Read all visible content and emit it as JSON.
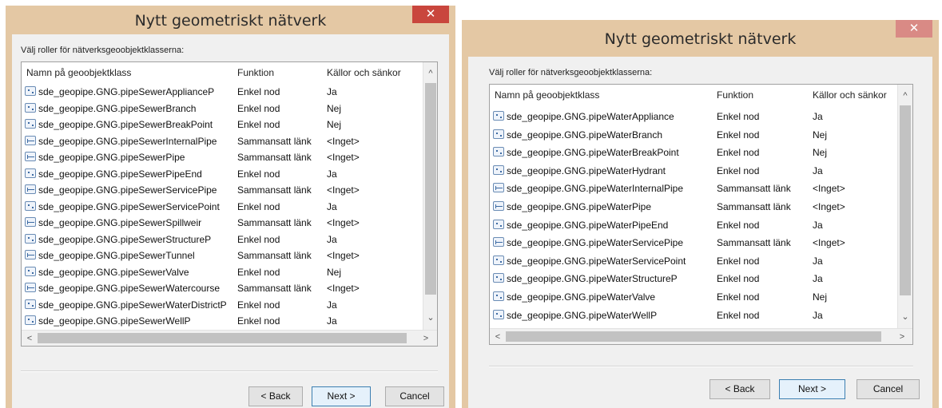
{
  "left_dialog": {
    "title": "Nytt geometriskt nätverk",
    "close": "✕",
    "prompt": "Välj roller för nätverksgeoobjektklasserna:",
    "columns": [
      "Namn på geoobjektklass",
      "Funktion",
      "Källor och sänkor"
    ],
    "rows": [
      {
        "icon": "point",
        "name": "sde_geopipe.GNG.pipeSewerApplianceP",
        "function": "Enkel nod",
        "sources": "Ja"
      },
      {
        "icon": "point",
        "name": "sde_geopipe.GNG.pipeSewerBranch",
        "function": "Enkel nod",
        "sources": "Nej"
      },
      {
        "icon": "point",
        "name": "sde_geopipe.GNG.pipeSewerBreakPoint",
        "function": "Enkel nod",
        "sources": "Nej"
      },
      {
        "icon": "line",
        "name": "sde_geopipe.GNG.pipeSewerInternalPipe",
        "function": "Sammansatt länk",
        "sources": "<Inget>"
      },
      {
        "icon": "line",
        "name": "sde_geopipe.GNG.pipeSewerPipe",
        "function": "Sammansatt länk",
        "sources": "<Inget>"
      },
      {
        "icon": "point",
        "name": "sde_geopipe.GNG.pipeSewerPipeEnd",
        "function": "Enkel nod",
        "sources": "Ja"
      },
      {
        "icon": "line",
        "name": "sde_geopipe.GNG.pipeSewerServicePipe",
        "function": "Sammansatt länk",
        "sources": "<Inget>"
      },
      {
        "icon": "point",
        "name": "sde_geopipe.GNG.pipeSewerServicePoint",
        "function": "Enkel nod",
        "sources": "Ja"
      },
      {
        "icon": "line",
        "name": "sde_geopipe.GNG.pipeSewerSpillweir",
        "function": "Sammansatt länk",
        "sources": "<Inget>"
      },
      {
        "icon": "point",
        "name": "sde_geopipe.GNG.pipeSewerStructureP",
        "function": "Enkel nod",
        "sources": "Ja"
      },
      {
        "icon": "line",
        "name": "sde_geopipe.GNG.pipeSewerTunnel",
        "function": "Sammansatt länk",
        "sources": "<Inget>"
      },
      {
        "icon": "point",
        "name": "sde_geopipe.GNG.pipeSewerValve",
        "function": "Enkel nod",
        "sources": "Nej"
      },
      {
        "icon": "line",
        "name": "sde_geopipe.GNG.pipeSewerWatercourse",
        "function": "Sammansatt länk",
        "sources": "<Inget>"
      },
      {
        "icon": "point",
        "name": "sde_geopipe.GNG.pipeSewerWaterDistrictP",
        "function": "Enkel nod",
        "sources": "Ja"
      },
      {
        "icon": "point",
        "name": "sde_geopipe.GNG.pipeSewerWellP",
        "function": "Enkel nod",
        "sources": "Ja"
      }
    ],
    "buttons": {
      "back": "< Back",
      "next": "Next >",
      "cancel": "Cancel"
    }
  },
  "right_dialog": {
    "title": "Nytt geometriskt nätverk",
    "close": "✕",
    "prompt": "Välj roller för nätverksgeoobjektklasserna:",
    "columns": [
      "Namn på geoobjektklass",
      "Funktion",
      "Källor och sänkor"
    ],
    "rows": [
      {
        "icon": "point",
        "name": "sde_geopipe.GNG.pipeWaterAppliance",
        "function": "Enkel nod",
        "sources": "Ja"
      },
      {
        "icon": "point",
        "name": "sde_geopipe.GNG.pipeWaterBranch",
        "function": "Enkel nod",
        "sources": "Nej"
      },
      {
        "icon": "point",
        "name": "sde_geopipe.GNG.pipeWaterBreakPoint",
        "function": "Enkel nod",
        "sources": "Nej"
      },
      {
        "icon": "point",
        "name": "sde_geopipe.GNG.pipeWaterHydrant",
        "function": "Enkel nod",
        "sources": "Ja"
      },
      {
        "icon": "line",
        "name": "sde_geopipe.GNG.pipeWaterInternalPipe",
        "function": "Sammansatt länk",
        "sources": "<Inget>"
      },
      {
        "icon": "line",
        "name": "sde_geopipe.GNG.pipeWaterPipe",
        "function": "Sammansatt länk",
        "sources": "<Inget>"
      },
      {
        "icon": "point",
        "name": "sde_geopipe.GNG.pipeWaterPipeEnd",
        "function": "Enkel nod",
        "sources": "Ja"
      },
      {
        "icon": "line",
        "name": "sde_geopipe.GNG.pipeWaterServicePipe",
        "function": "Sammansatt länk",
        "sources": "<Inget>"
      },
      {
        "icon": "point",
        "name": "sde_geopipe.GNG.pipeWaterServicePoint",
        "function": "Enkel nod",
        "sources": "Ja"
      },
      {
        "icon": "point",
        "name": "sde_geopipe.GNG.pipeWaterStructureP",
        "function": "Enkel nod",
        "sources": "Ja"
      },
      {
        "icon": "point",
        "name": "sde_geopipe.GNG.pipeWaterValve",
        "function": "Enkel nod",
        "sources": "Nej"
      },
      {
        "icon": "point",
        "name": "sde_geopipe.GNG.pipeWaterWellP",
        "function": "Enkel nod",
        "sources": "Ja"
      }
    ],
    "buttons": {
      "back": "< Back",
      "next": "Next >",
      "cancel": "Cancel"
    }
  },
  "scroll_arrows": {
    "up": "^",
    "down": "⌄",
    "left": "<",
    "right": ">"
  }
}
